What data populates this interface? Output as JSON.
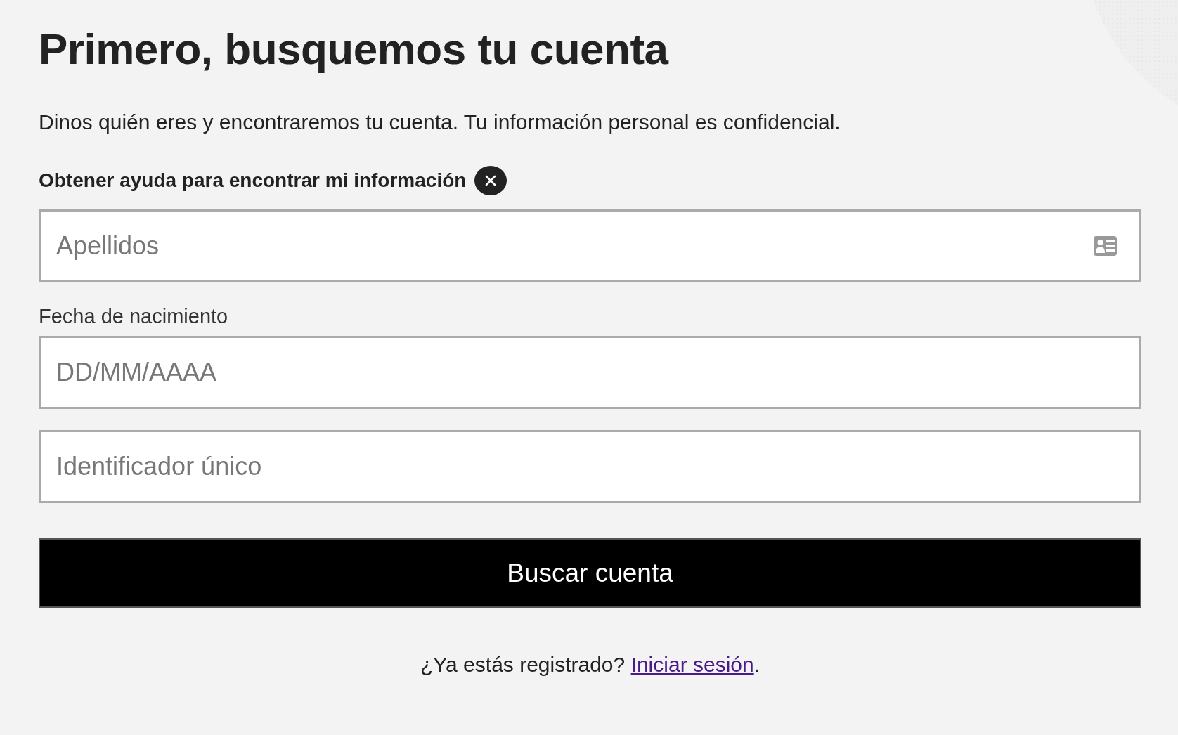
{
  "title": "Primero, busquemos tu cuenta",
  "intro": "Dinos quién eres y encontraremos tu cuenta. Tu información personal es confidencial.",
  "help_toggle": {
    "label": "Obtener ayuda para encontrar mi información",
    "expanded": true
  },
  "fields": [
    {
      "kind": "card",
      "placeholder": "Apellidos"
    },
    {
      "kind": "plain",
      "label": "Fecha de nacimiento",
      "placeholder": "DD/MM/AAAA"
    },
    {
      "kind": "plain",
      "placeholder": "Identificador único"
    }
  ],
  "submit": "Buscar cuenta",
  "footer": {
    "question": "¿Ya estás registrado?",
    "link": "Iniciar sesión",
    "end": "."
  }
}
